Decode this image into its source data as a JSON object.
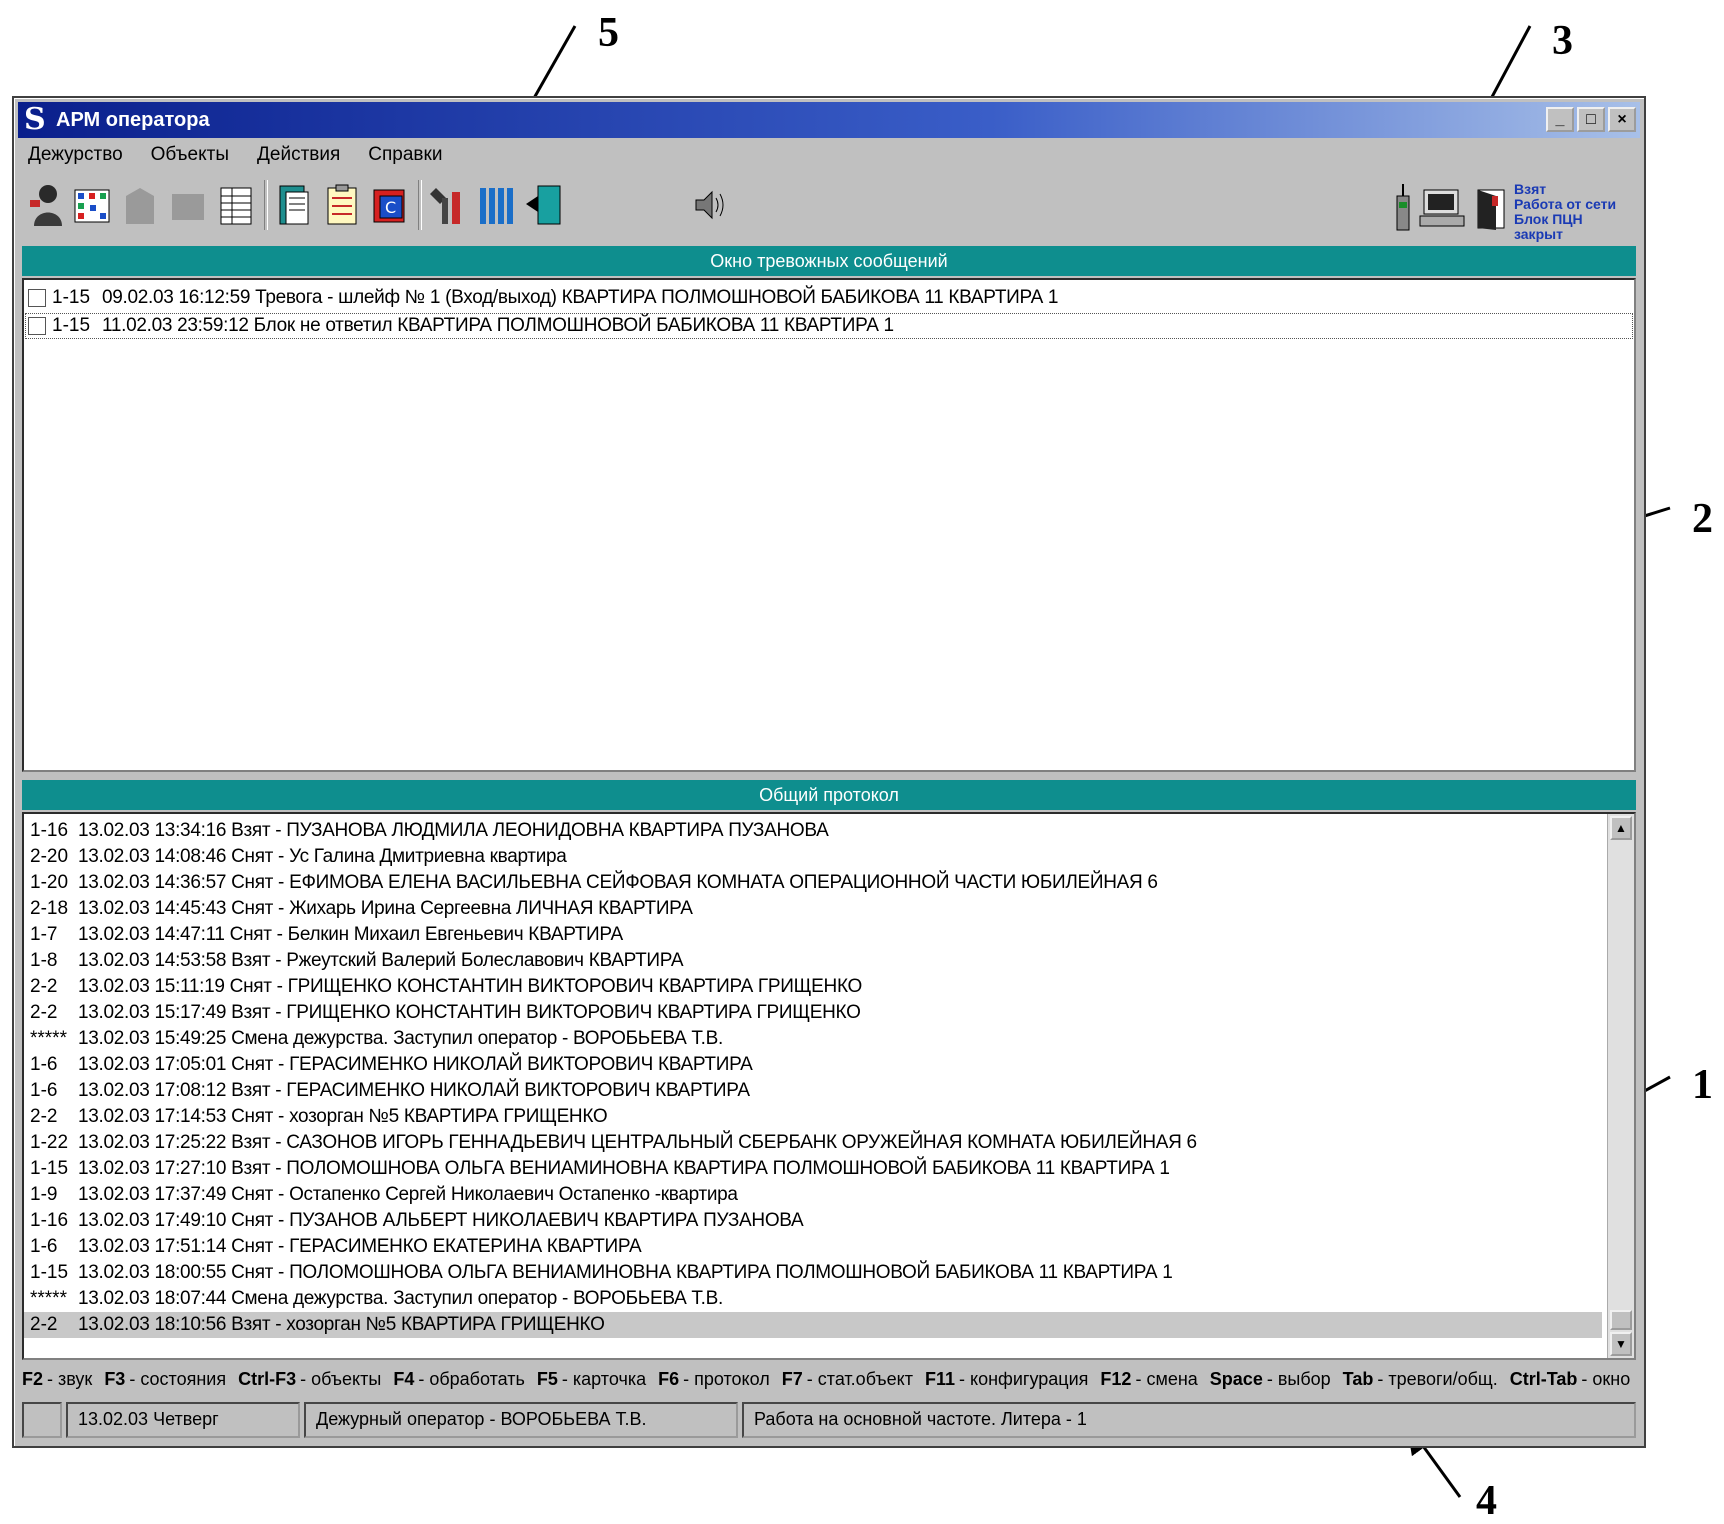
{
  "window": {
    "title": "АРМ оператора",
    "app_icon": "app-logo-icon",
    "controls": [
      "minimize-icon",
      "maximize-icon",
      "close-icon"
    ]
  },
  "menu": [
    "Дежурство",
    "Объекты",
    "Действия",
    "Справки"
  ],
  "toolbar": {
    "buttons": [
      "operator-icon",
      "grid-map-icon",
      "object-disabled-icon",
      "card-disabled-icon",
      "table-icon",
      "report-icon",
      "checklist-icon",
      "print-c-icon",
      "tools-icon",
      "columns-icon",
      "exit-door-icon",
      "speaker-icon"
    ]
  },
  "status_indicators": {
    "icons": [
      "radio-icon",
      "computer-icon",
      "door-icon"
    ],
    "lines": [
      "Взят",
      "Работа от сети",
      "Блок ПЦН закрыт"
    ]
  },
  "alarms": {
    "header": "Окно тревожных сообщений",
    "rows": [
      {
        "zone": "1-15",
        "text": "09.02.03 16:12:59  Тревога - шлейф № 1 (Вход/выход)  КВАРТИРА ПОЛМОШНОВОЙ БАБИКОВА 11 КВАРТИРА 1"
      },
      {
        "zone": "1-15",
        "text": "11.02.03 23:59:12  Блок не ответил  КВАРТИРА ПОЛМОШНОВОЙ БАБИКОВА 11 КВАРТИРА 1"
      }
    ]
  },
  "protocol": {
    "header": "Общий протокол",
    "rows": [
      {
        "zone": "1-16",
        "text": "13.02.03 13:34:16  Взят - ПУЗАНОВА ЛЮДМИЛА ЛЕОНИДОВНА  КВАРТИРА ПУЗАНОВА"
      },
      {
        "zone": "2-20",
        "text": "13.02.03 14:08:46  Снят - Ус Галина Дмитриевна  квартира"
      },
      {
        "zone": "1-20",
        "text": "13.02.03 14:36:57  Снят - ЕФИМОВА ЕЛЕНА ВАСИЛЬЕВНА  СЕЙФОВАЯ КОМНАТА ОПЕРАЦИОННОЙ  ЧАСТИ  ЮБИЛЕЙНАЯ 6"
      },
      {
        "zone": "2-18",
        "text": "13.02.03 14:45:43  Снят - Жихарь Ирина Сергеевна  ЛИЧНАЯ  КВАРТИРА"
      },
      {
        "zone": "1-7",
        "text": "13.02.03 14:47:11  Снят - Белкин Михаил  Евгеньевич  КВАРТИРА"
      },
      {
        "zone": "1-8",
        "text": "13.02.03 14:53:58  Взят - Ржеутский  Валерий  Болеславович  КВАРТИРА"
      },
      {
        "zone": "2-2",
        "text": "13.02.03 15:11:19  Снят - ГРИЩЕНКО КОНСТАНТИН ВИКТОРОВИЧ  КВАРТИРА ГРИЩЕНКО"
      },
      {
        "zone": "2-2",
        "text": "13.02.03 15:17:49  Взят - ГРИЩЕНКО КОНСТАНТИН ВИКТОРОВИЧ  КВАРТИРА ГРИЩЕНКО"
      },
      {
        "zone": "*****",
        "text": "13.02.03 15:49:25  Смена дежурства. Заступил оператор - ВОРОБЬЕВА Т.В."
      },
      {
        "zone": "1-6",
        "text": "13.02.03 17:05:01  Снят - ГЕРАСИМЕНКО  НИКОЛАЙ  ВИКТОРОВИЧ  КВАРТИРА"
      },
      {
        "zone": "1-6",
        "text": "13.02.03 17:08:12  Взят - ГЕРАСИМЕНКО  НИКОЛАЙ  ВИКТОРОВИЧ  КВАРТИРА"
      },
      {
        "zone": "2-2",
        "text": "13.02.03 17:14:53  Снят - хозорган №5  КВАРТИРА ГРИЩЕНКО"
      },
      {
        "zone": "1-22",
        "text": "13.02.03 17:25:22  Взят - САЗОНОВ ИГОРЬ ГЕННАДЬЕВИЧ  ЦЕНТРАЛЬНЫЙ СБЕРБАНК  ОРУЖЕЙНАЯ КОМНАТА   ЮБИЛЕЙНАЯ 6"
      },
      {
        "zone": "1-15",
        "text": "13.02.03 17:27:10  Взят - ПОЛОМОШНОВА ОЛЬГА ВЕНИАМИНОВНА  КВАРТИРА ПОЛМОШНОВОЙ БАБИКОВА 11 КВАРТИРА 1"
      },
      {
        "zone": "1-9",
        "text": "13.02.03 17:37:49  Снят - Остапенко Сергей Николаевич  Остапенко -квартира"
      },
      {
        "zone": "1-16",
        "text": "13.02.03 17:49:10  Снят - ПУЗАНОВ АЛЬБЕРТ НИКОЛАЕВИЧ  КВАРТИРА ПУЗАНОВА"
      },
      {
        "zone": "1-6",
        "text": "13.02.03 17:51:14  Снят - ГЕРАСИМЕНКО  ЕКАТЕРИНА  КВАРТИРА"
      },
      {
        "zone": "1-15",
        "text": "13.02.03 18:00:55  Снят - ПОЛОМОШНОВА ОЛЬГА ВЕНИАМИНОВНА  КВАРТИРА ПОЛМОШНОВОЙ БАБИКОВА 11 КВАРТИРА 1"
      },
      {
        "zone": "*****",
        "text": "13.02.03 18:07:44  Смена дежурства. Заступил оператор - ВОРОБЬЕВА Т.В."
      },
      {
        "zone": "2-2",
        "text": "13.02.03 18:10:56  Взят - хозорган №5  КВАРТИРА ГРИЩЕНКО"
      }
    ]
  },
  "hotkeys": [
    {
      "key": "F2",
      "desc": "- звук"
    },
    {
      "key": "F3",
      "desc": "- состояния"
    },
    {
      "key": "Ctrl-F3",
      "desc": "- объекты"
    },
    {
      "key": "F4",
      "desc": "- обработать"
    },
    {
      "key": "F5",
      "desc": "- карточка"
    },
    {
      "key": "F6",
      "desc": "- протокол"
    },
    {
      "key": "F7",
      "desc": "- стат.объект"
    },
    {
      "key": "F11",
      "desc": "- конфигурация"
    },
    {
      "key": "F12",
      "desc": "- смена"
    },
    {
      "key": "Space",
      "desc": "- выбор"
    },
    {
      "key": "Tab",
      "desc": "- тревоги/общ."
    },
    {
      "key": "Ctrl-Tab",
      "desc": "- окно"
    }
  ],
  "statusbar": {
    "date": "13.02.03 Четверг",
    "operator": "Дежурный оператор - ВОРОБЬЕВА Т.В.",
    "mode": "Работа на основной частоте. Литера - 1"
  },
  "callouts": {
    "c1": "1",
    "c2": "2",
    "c3": "3",
    "c4": "4",
    "c5": "5"
  },
  "colors": {
    "title_gradient_start": "#0a1f8c",
    "panel_header": "#0e8e8e",
    "status_text": "#1a3ab4"
  }
}
